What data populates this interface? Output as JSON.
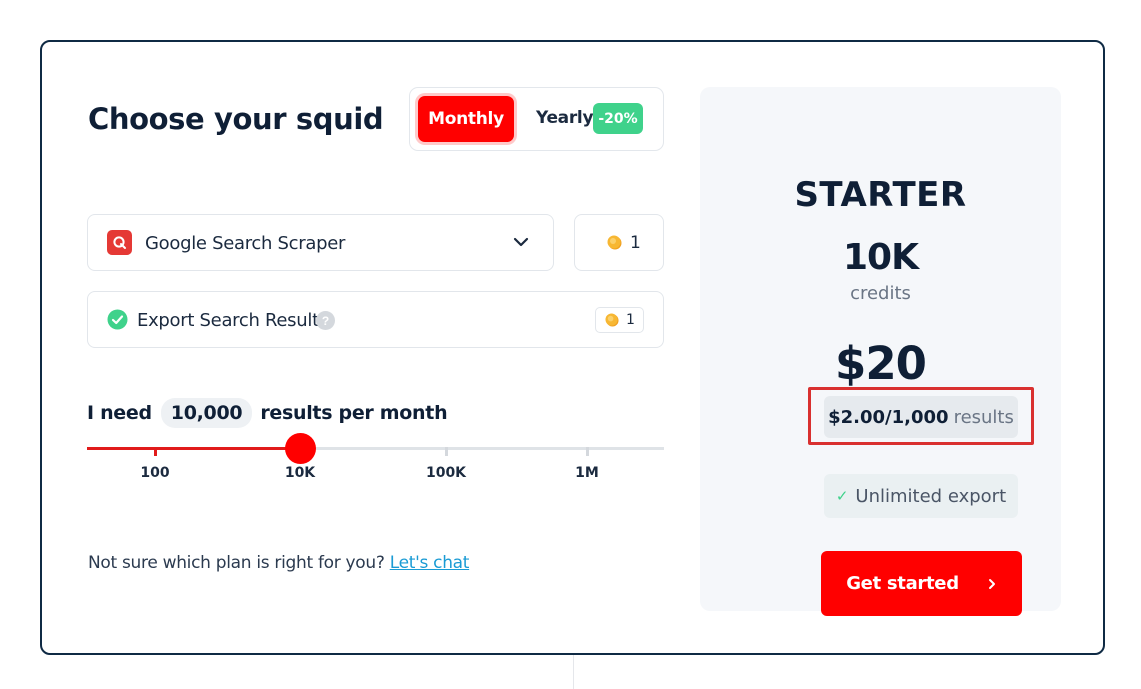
{
  "page": {
    "title": "Choose your squid"
  },
  "billing_toggle": {
    "monthly_label": "Monthly",
    "yearly_label": "Yearly",
    "yearly_discount": "-20%",
    "selected": "Monthly"
  },
  "scraper_select": {
    "icon": "q-logo-icon",
    "label": "Google Search Scraper",
    "credits": "1"
  },
  "addon": {
    "label": "Export Search Results",
    "help": "?",
    "credits": "1",
    "checked": true
  },
  "usage": {
    "prefix": "I need",
    "value": "10,000",
    "suffix": "results per month",
    "ticks": [
      "100",
      "10K",
      "100K",
      "1M"
    ],
    "selected_index": 1
  },
  "help": {
    "text": "Not sure which plan is right for you?",
    "link": "Let's chat"
  },
  "plan": {
    "name": "STARTER",
    "credits_amount": "10K",
    "credits_unit": "credits",
    "price": "$20",
    "rate": "$2.00/1,000",
    "rate_unit": "results",
    "feature": "Unlimited export",
    "cta": "Get started",
    "cta_icon": "chevron-right-icon"
  },
  "colors": {
    "accent": "#ff0000",
    "discount": "#3fd28b",
    "link": "#1a9bd4",
    "highlight_border": "#d9302f"
  }
}
